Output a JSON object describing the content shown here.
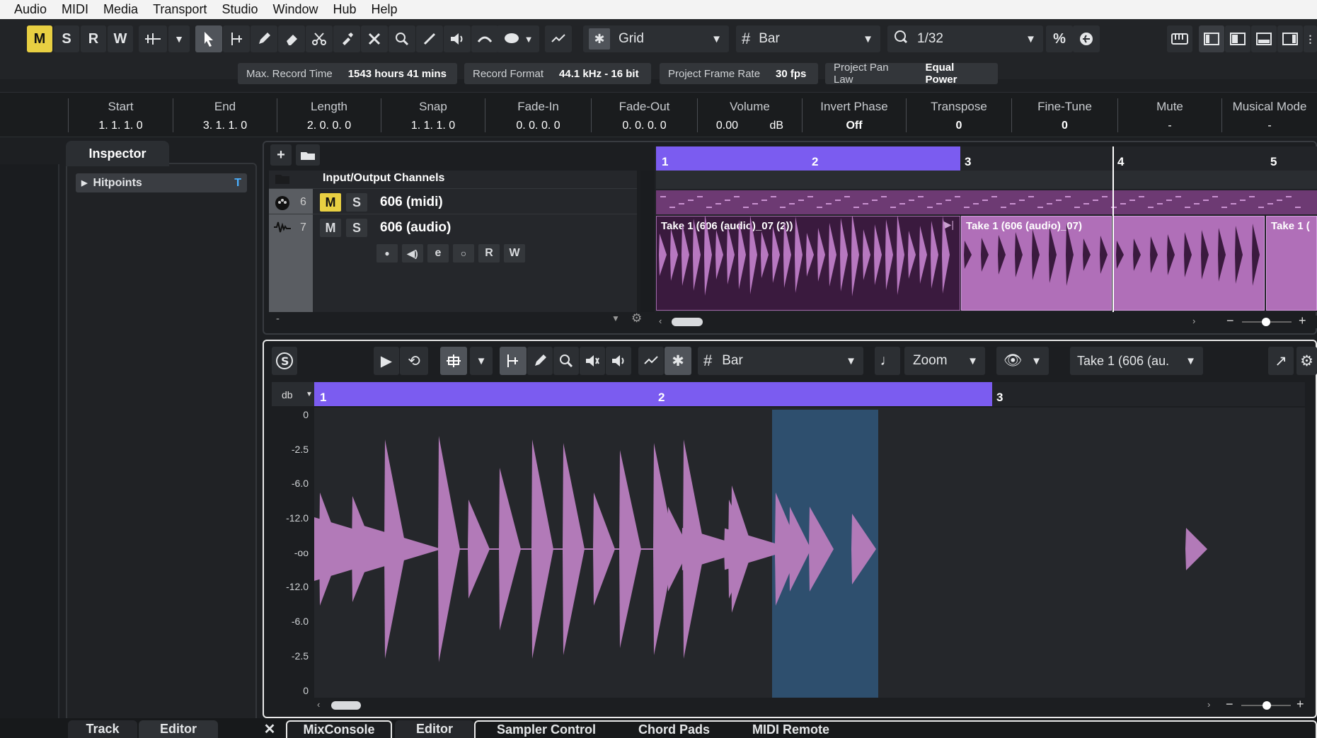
{
  "menu": [
    "Audio",
    "MIDI",
    "Media",
    "Transport",
    "Studio",
    "Window",
    "Hub",
    "Help"
  ],
  "toolbar": {
    "m": "M",
    "s": "S",
    "r": "R",
    "w": "W",
    "snap_type": "Grid",
    "grid_type": "Bar",
    "quantize": "1/32"
  },
  "status": {
    "max_rec_label": "Max. Record Time",
    "max_rec_value": "1543 hours 41 mins",
    "rec_fmt_label": "Record Format",
    "rec_fmt_value": "44.1 kHz - 16 bit",
    "frame_label": "Project Frame Rate",
    "frame_value": "30 fps",
    "pan_label": "Project Pan Law",
    "pan_value": "Equal Power"
  },
  "infoline": [
    {
      "h": "Start",
      "v": "1. 1. 1.   0"
    },
    {
      "h": "End",
      "v": "3. 1. 1.   0"
    },
    {
      "h": "Length",
      "v": "2. 0. 0.   0"
    },
    {
      "h": "Snap",
      "v": "1. 1. 1.   0"
    },
    {
      "h": "Fade-In",
      "v": "0. 0. 0.   0"
    },
    {
      "h": "Fade-Out",
      "v": "0. 0. 0.   0"
    },
    {
      "h": "Volume",
      "v": "0.00          dB"
    },
    {
      "h": "Invert Phase",
      "v": "Off"
    },
    {
      "h": "Transpose",
      "v": "0"
    },
    {
      "h": "Fine-Tune",
      "v": "0"
    },
    {
      "h": "Mute",
      "v": "-"
    },
    {
      "h": "Musical Mode",
      "v": "-"
    }
  ],
  "inspector": {
    "tab": "Inspector",
    "section": "Hitpoints"
  },
  "tracks": {
    "folder": "Input/Output Channels",
    "t6_num": "6",
    "t6_name": "606 (midi)",
    "t7_num": "7",
    "t7_name": "606 (audio)",
    "m": "M",
    "s": "S",
    "r": "R",
    "w": "W",
    "dash": "-"
  },
  "ruler": {
    "b1": "1",
    "b2": "2",
    "b3": "3",
    "b4": "4",
    "b5": "5"
  },
  "events": {
    "e1": "Take 1 (606 (audio)_07 (2))",
    "e2": "Take 1 (606 (audio)_07)",
    "e3": "Take 1 ("
  },
  "editor": {
    "grid": "Bar",
    "zoom": "Zoom",
    "clip": "Take 1 (606 (au.",
    "db": "db",
    "b1": "1",
    "b2": "2",
    "b3": "3"
  },
  "db_scale": [
    "0",
    "-2.5",
    "-6.0",
    "-12.0",
    "-oo",
    "-12.0",
    "-6.0",
    "-2.5",
    "0"
  ],
  "bottom": {
    "track": "Track",
    "editor": "Editor",
    "mix": "MixConsole",
    "editor2": "Editor",
    "sampler": "Sampler Control",
    "chord": "Chord Pads",
    "midi": "MIDI Remote"
  }
}
